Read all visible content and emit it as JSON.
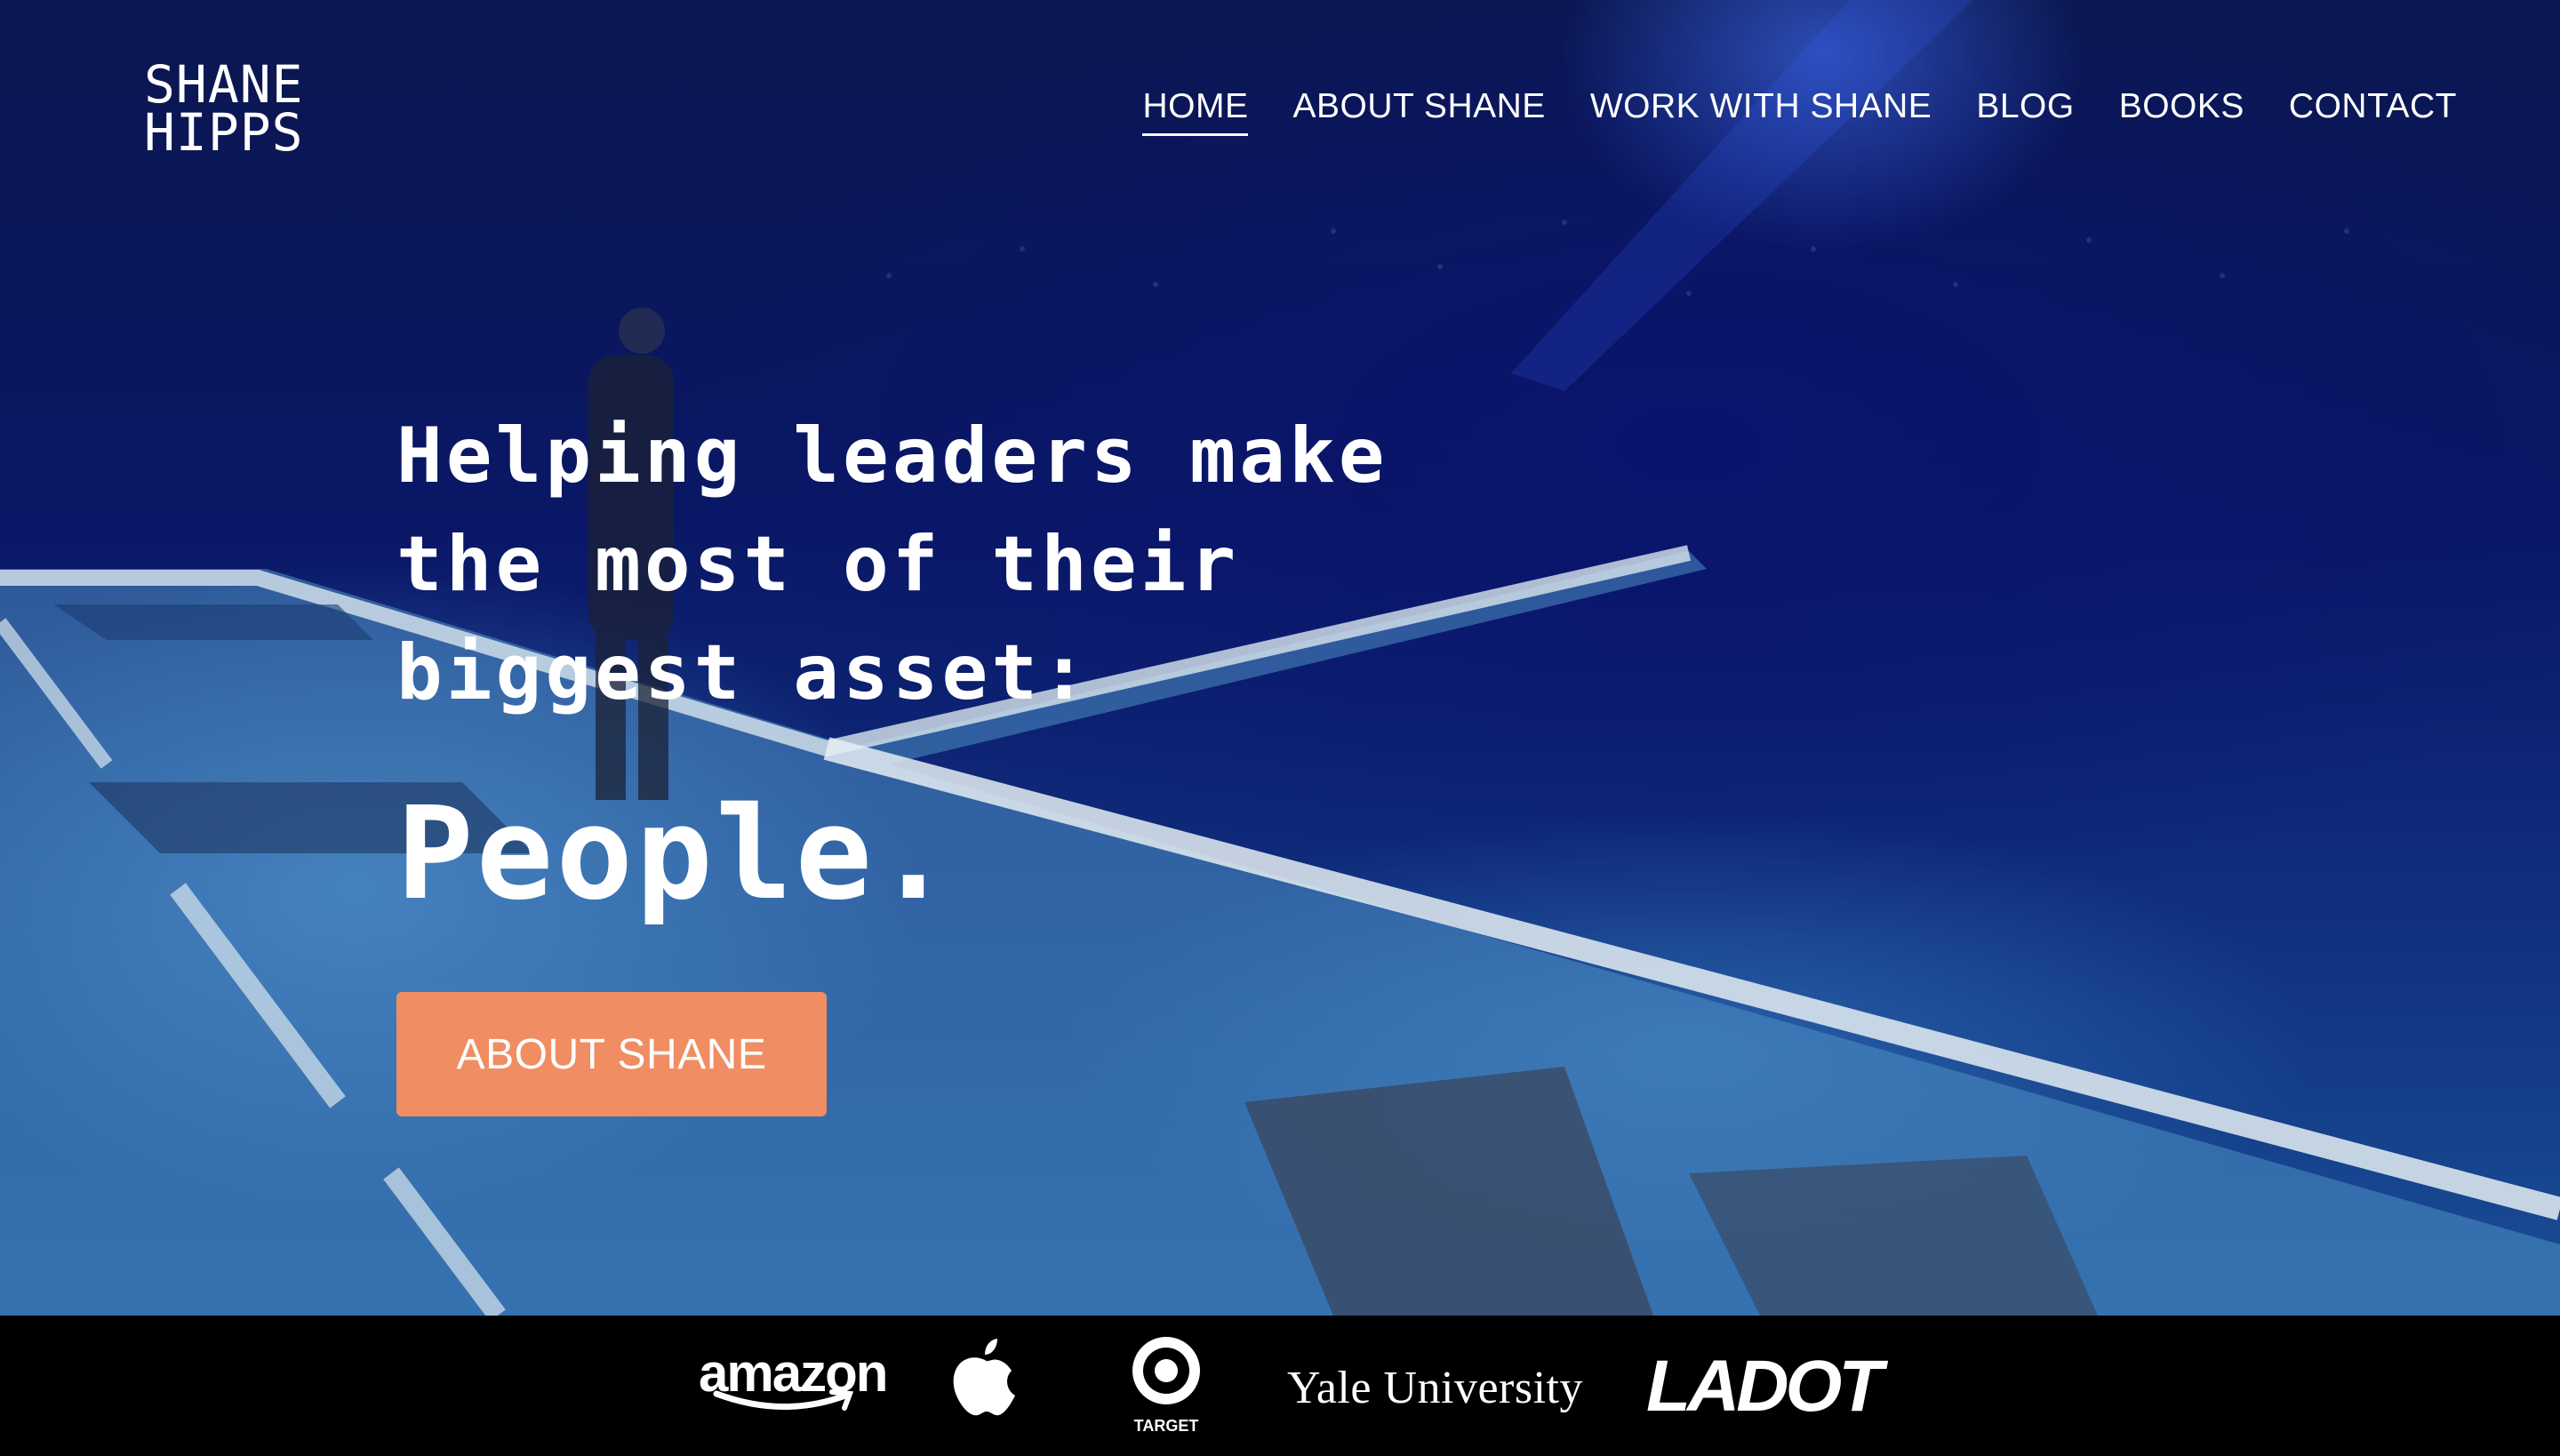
{
  "brand": {
    "line1": "SHANE",
    "line2": "HIPPS"
  },
  "nav": {
    "items": [
      {
        "label": "HOME",
        "active": true
      },
      {
        "label": "ABOUT SHANE",
        "active": false
      },
      {
        "label": "WORK WITH SHANE",
        "active": false
      },
      {
        "label": "BLOG",
        "active": false
      },
      {
        "label": "BOOKS",
        "active": false
      },
      {
        "label": "CONTACT",
        "active": false
      }
    ]
  },
  "hero": {
    "headline_lines": [
      "Helping leaders make",
      "the most of their",
      "biggest asset:"
    ],
    "emphasis": "People.",
    "cta_label": "ABOUT SHANE",
    "background": "stage-photo"
  },
  "clients": {
    "logos": [
      {
        "name": "amazon",
        "text": "amazon"
      },
      {
        "name": "apple",
        "icon": "apple-logo"
      },
      {
        "name": "target",
        "text": "TARGET"
      },
      {
        "name": "yale",
        "text": "Yale University"
      },
      {
        "name": "ladot",
        "text": "LADOT"
      }
    ]
  },
  "colors": {
    "cta": "#f08d63",
    "hero_tint": "#0a1766",
    "clients_bar": "#000000",
    "text": "#ffffff"
  }
}
